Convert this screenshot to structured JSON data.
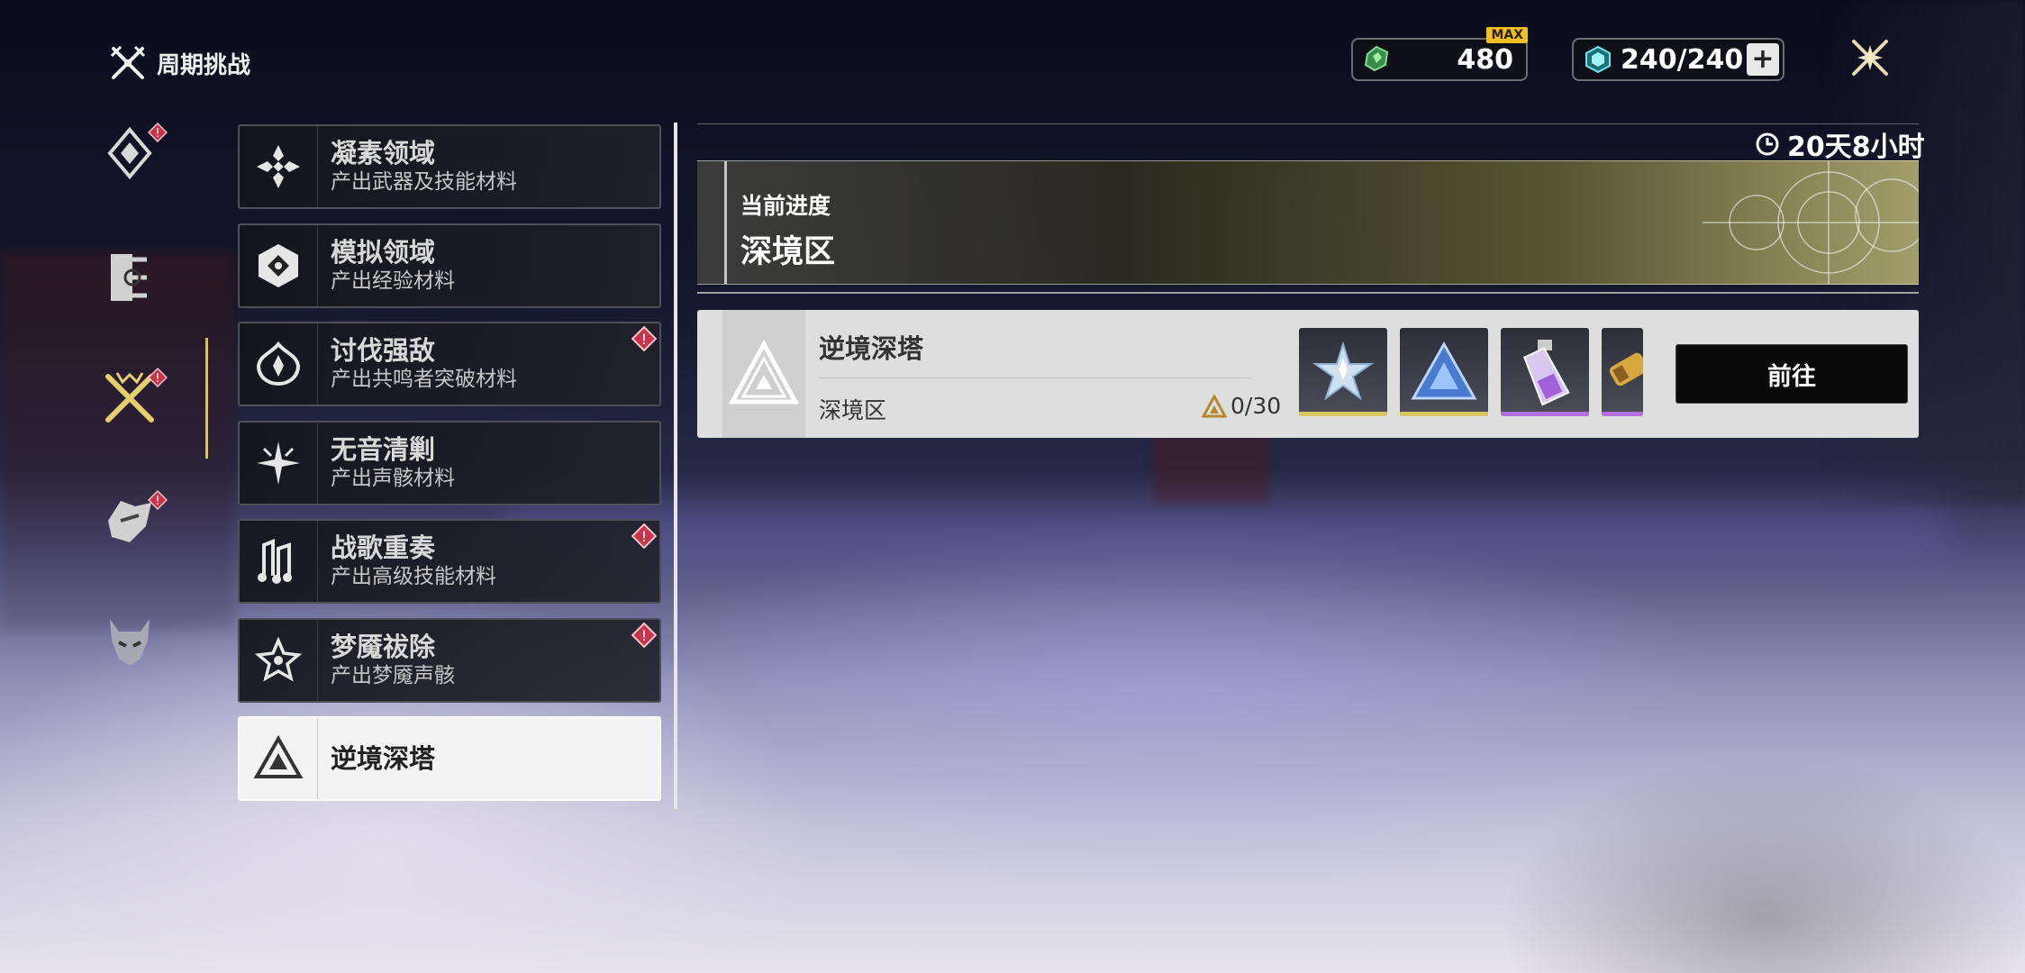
{
  "header": {
    "title": "周期挑战",
    "currency_1": {
      "value": "480",
      "badge": "MAX"
    },
    "currency_2": {
      "value": "240/240"
    }
  },
  "rail": {
    "items": [
      {
        "icon": "compass-icon",
        "badge": true
      },
      {
        "icon": "scroll-icon",
        "badge": false
      },
      {
        "icon": "crossed-swords-icon",
        "badge": true,
        "active": true
      },
      {
        "icon": "mask-icon",
        "badge": true
      },
      {
        "icon": "demon-icon",
        "badge": false
      }
    ]
  },
  "challenges": [
    {
      "title": "凝素领域",
      "subtitle": "产出武器及技能材料",
      "badge": false
    },
    {
      "title": "模拟领域",
      "subtitle": "产出经验材料",
      "badge": false
    },
    {
      "title": "讨伐强敌",
      "subtitle": "产出共鸣者突破材料",
      "badge": true
    },
    {
      "title": "无音清剿",
      "subtitle": "产出声骸材料",
      "badge": false
    },
    {
      "title": "战歌重奏",
      "subtitle": "产出高级技能材料",
      "badge": true
    },
    {
      "title": "梦魇祓除",
      "subtitle": "产出梦魇声骸",
      "badge": true
    },
    {
      "title": "逆境深塔",
      "subtitle": "",
      "badge": false,
      "active": true
    }
  ],
  "detail": {
    "timer": "20天8小时",
    "progress_label": "当前进度",
    "progress_value": "深境区",
    "tower": {
      "name": "逆境深塔",
      "area": "深境区",
      "progress": "0/30",
      "go_label": "前往",
      "rewards": [
        {
          "icon": "star-crystal-icon",
          "rarity_color": "#d8c860"
        },
        {
          "icon": "blue-triangle-crystal-icon",
          "rarity_color": "#d8c860"
        },
        {
          "icon": "potion-vial-icon",
          "rarity_color": "#b070e0"
        },
        {
          "icon": "scroll-item-icon",
          "rarity_color": "#b070e0"
        }
      ]
    }
  },
  "colors": {
    "accent_gold": "#d8c070",
    "alert_red": "#c8344a",
    "card_active": "#f3f3f3"
  }
}
